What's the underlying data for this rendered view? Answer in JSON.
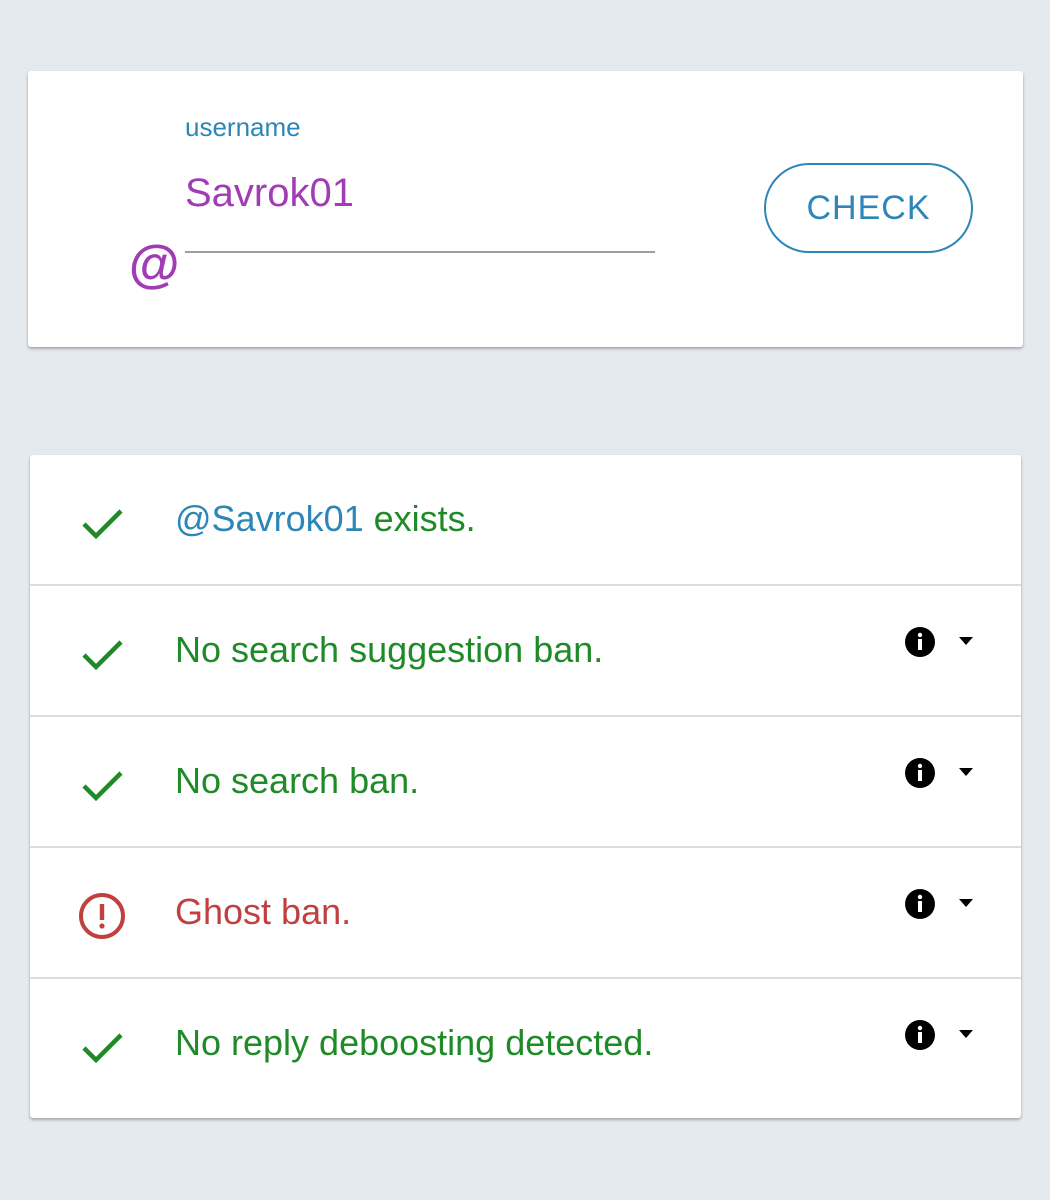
{
  "form": {
    "at_symbol": "@",
    "label": "username",
    "value": "Savrok01",
    "button_label": "CHECK"
  },
  "results": [
    {
      "handle": "@Savrok01",
      "text": " exists.",
      "status": "ok",
      "icon": "check-icon",
      "has_details": false
    },
    {
      "text": "No search suggestion ban.",
      "status": "ok",
      "icon": "check-icon",
      "has_details": true
    },
    {
      "text": "No search ban.",
      "status": "ok",
      "icon": "check-icon",
      "has_details": true
    },
    {
      "text": "Ghost ban.",
      "status": "bad",
      "icon": "alert-circle-icon",
      "has_details": true
    },
    {
      "text": "No reply deboosting detected.",
      "status": "ok",
      "icon": "check-icon",
      "has_details": true
    }
  ],
  "colors": {
    "page_background": "#e5eaef",
    "accent_blue": "#2d86b8",
    "accent_purple": "#a03cb4",
    "ok_green": "#1f8a28",
    "error_red": "#c04040"
  }
}
